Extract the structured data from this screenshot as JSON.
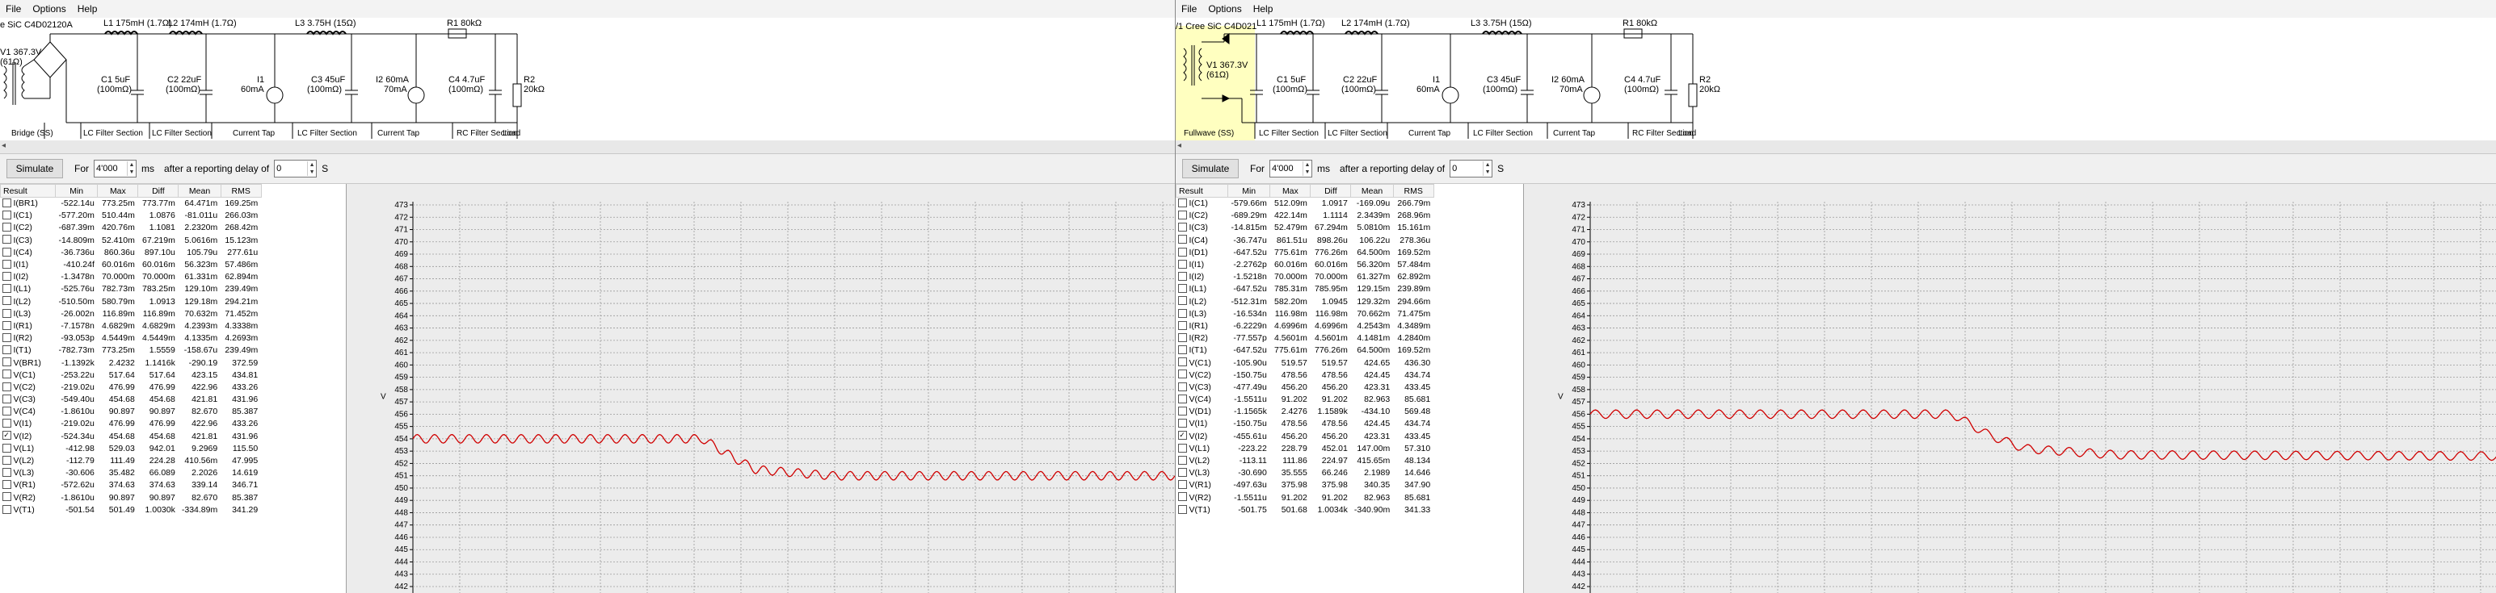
{
  "menu": [
    "File",
    "Options",
    "Help"
  ],
  "toolbar": {
    "simulate_label": "Simulate",
    "for_label": "For",
    "duration_value": "4'000",
    "ms_label": "ms",
    "delay_label": "after a reporting delay of",
    "delay_value": "0",
    "s_label": "S"
  },
  "columns": [
    "Result",
    "Min",
    "Max",
    "Diff",
    "Mean",
    "RMS"
  ],
  "colors": {
    "trace": "#d00000",
    "grid": "#9a9a9a",
    "highlight": "#ffffc0"
  },
  "chart_data": [
    {
      "type": "line",
      "ylim": [
        442,
        473
      ],
      "y_ticks": [
        "473",
        "472",
        "471",
        "470",
        "469",
        "468",
        "467",
        "466",
        "465",
        "464",
        "463",
        "462",
        "461",
        "460",
        "459",
        "458",
        "457",
        "456",
        "455",
        "454",
        "453",
        "452",
        "451",
        "450",
        "449",
        "448",
        "447",
        "446",
        "445",
        "444",
        "443",
        "442"
      ],
      "ylabel": "V",
      "grid": true,
      "series": [
        {
          "x_frac": [
            0.0,
            0.38,
            0.42,
            0.45,
            0.55,
            1.0
          ],
          "values": [
            454.0,
            454.0,
            452.5,
            451.5,
            451.0,
            451.0
          ],
          "ripple": 0.35
        }
      ]
    },
    {
      "type": "line",
      "ylim": [
        442,
        473
      ],
      "y_ticks": [
        "473",
        "472",
        "471",
        "470",
        "469",
        "468",
        "467",
        "466",
        "465",
        "464",
        "463",
        "462",
        "461",
        "460",
        "459",
        "458",
        "457",
        "456",
        "455",
        "454",
        "453",
        "452",
        "451",
        "450",
        "449",
        "448",
        "447",
        "446",
        "445",
        "444",
        "443",
        "442"
      ],
      "ylabel": "V",
      "grid": true,
      "series": [
        {
          "x_frac": [
            0.0,
            0.4,
            0.44,
            0.48,
            0.58,
            1.0
          ],
          "values": [
            456.0,
            456.0,
            454.3,
            453.2,
            452.7,
            452.6
          ],
          "ripple": 0.35
        }
      ]
    }
  ],
  "left": {
    "schematic": {
      "source_label": "V1 367.3V",
      "source_res": "(61Ω)",
      "source_name": "e SiC C4D02120A",
      "l1_label": "L1 175mH (1.7Ω)",
      "l2_label": "L2 174mH (1.7Ω)",
      "l3_label": "L3 3.75H (15Ω)",
      "r1_label": "R1 80kΩ",
      "c1_label": "C1 5uF",
      "c1_esr": "(100mΩ)",
      "c2_label": "C2 22uF",
      "c2_esr": "(100mΩ)",
      "i1_label": "I1",
      "i1_val": "60mA",
      "c3_label": "C3 45uF",
      "c3_esr": "(100mΩ)",
      "i2_label": "I2 60mA",
      "i2_val": "70mA",
      "c4_label": "C4 4.7uF",
      "c4_esr": "(100mΩ)",
      "r2_label": "R2",
      "r2_val": "20kΩ",
      "sections": [
        "Bridge (SS)",
        "LC Filter Section",
        "LC Filter Section",
        "Current Tap",
        "LC Filter Section",
        "Current Tap",
        "RC Filter Section",
        "Load"
      ]
    },
    "rows": [
      {
        "name": "I(BR1)",
        "min": "-522.14u",
        "max": "773.25m",
        "diff": "773.77m",
        "mean": "64.471m",
        "rms": "169.25m",
        "checked": false
      },
      {
        "name": "I(C1)",
        "min": "-577.20m",
        "max": "510.44m",
        "diff": "1.0876",
        "mean": "-81.011u",
        "rms": "266.03m",
        "checked": false
      },
      {
        "name": "I(C2)",
        "min": "-687.39m",
        "max": "420.76m",
        "diff": "1.1081",
        "mean": "2.2320m",
        "rms": "268.42m",
        "checked": false
      },
      {
        "name": "I(C3)",
        "min": "-14.809m",
        "max": "52.410m",
        "diff": "67.219m",
        "mean": "5.0616m",
        "rms": "15.123m",
        "checked": false
      },
      {
        "name": "I(C4)",
        "min": "-36.736u",
        "max": "860.36u",
        "diff": "897.10u",
        "mean": "105.79u",
        "rms": "277.61u",
        "checked": false
      },
      {
        "name": "I(I1)",
        "min": "-410.24f",
        "max": "60.016m",
        "diff": "60.016m",
        "mean": "56.323m",
        "rms": "57.486m",
        "checked": false
      },
      {
        "name": "I(I2)",
        "min": "-1.3478n",
        "max": "70.000m",
        "diff": "70.000m",
        "mean": "61.331m",
        "rms": "62.894m",
        "checked": false
      },
      {
        "name": "I(L1)",
        "min": "-525.76u",
        "max": "782.73m",
        "diff": "783.25m",
        "mean": "129.10m",
        "rms": "239.49m",
        "checked": false
      },
      {
        "name": "I(L2)",
        "min": "-510.50m",
        "max": "580.79m",
        "diff": "1.0913",
        "mean": "129.18m",
        "rms": "294.21m",
        "checked": false
      },
      {
        "name": "I(L3)",
        "min": "-26.002n",
        "max": "116.89m",
        "diff": "116.89m",
        "mean": "70.632m",
        "rms": "71.452m",
        "checked": false
      },
      {
        "name": "I(R1)",
        "min": "-7.1578n",
        "max": "4.6829m",
        "diff": "4.6829m",
        "mean": "4.2393m",
        "rms": "4.3338m",
        "checked": false
      },
      {
        "name": "I(R2)",
        "min": "-93.053p",
        "max": "4.5449m",
        "diff": "4.5449m",
        "mean": "4.1335m",
        "rms": "4.2693m",
        "checked": false
      },
      {
        "name": "I(T1)",
        "min": "-782.73m",
        "max": "773.25m",
        "diff": "1.5559",
        "mean": "-158.67u",
        "rms": "239.49m",
        "checked": false
      },
      {
        "name": "V(BR1)",
        "min": "-1.1392k",
        "max": "2.4232",
        "diff": "1.1416k",
        "mean": "-290.19",
        "rms": "372.59",
        "checked": false
      },
      {
        "name": "V(C1)",
        "min": "-253.22u",
        "max": "517.64",
        "diff": "517.64",
        "mean": "423.15",
        "rms": "434.81",
        "checked": false
      },
      {
        "name": "V(C2)",
        "min": "-219.02u",
        "max": "476.99",
        "diff": "476.99",
        "mean": "422.96",
        "rms": "433.26",
        "checked": false
      },
      {
        "name": "V(C3)",
        "min": "-549.40u",
        "max": "454.68",
        "diff": "454.68",
        "mean": "421.81",
        "rms": "431.96",
        "checked": false
      },
      {
        "name": "V(C4)",
        "min": "-1.8610u",
        "max": "90.897",
        "diff": "90.897",
        "mean": "82.670",
        "rms": "85.387",
        "checked": false
      },
      {
        "name": "V(I1)",
        "min": "-219.02u",
        "max": "476.99",
        "diff": "476.99",
        "mean": "422.96",
        "rms": "433.26",
        "checked": false
      },
      {
        "name": "V(I2)",
        "min": "-524.34u",
        "max": "454.68",
        "diff": "454.68",
        "mean": "421.81",
        "rms": "431.96",
        "checked": true
      },
      {
        "name": "V(L1)",
        "min": "-412.98",
        "max": "529.03",
        "diff": "942.01",
        "mean": "9.2969",
        "rms": "115.50",
        "checked": false
      },
      {
        "name": "V(L2)",
        "min": "-112.79",
        "max": "111.49",
        "diff": "224.28",
        "mean": "410.56m",
        "rms": "47.995",
        "checked": false
      },
      {
        "name": "V(L3)",
        "min": "-30.606",
        "max": "35.482",
        "diff": "66.089",
        "mean": "2.2026",
        "rms": "14.619",
        "checked": false
      },
      {
        "name": "V(R1)",
        "min": "-572.62u",
        "max": "374.63",
        "diff": "374.63",
        "mean": "339.14",
        "rms": "346.71",
        "checked": false
      },
      {
        "name": "V(R2)",
        "min": "-1.8610u",
        "max": "90.897",
        "diff": "90.897",
        "mean": "82.670",
        "rms": "85.387",
        "checked": false
      },
      {
        "name": "V(T1)",
        "min": "-501.54",
        "max": "501.49",
        "diff": "1.0030k",
        "mean": "-334.89m",
        "rms": "341.29",
        "checked": false
      }
    ]
  },
  "right": {
    "schematic": {
      "source_label": "V1 367.3V",
      "source_res": "(61Ω)",
      "source_name": "/1 Cree SiC C4D021",
      "l1_label": "L1 175mH (1.7Ω)",
      "l2_label": "L2 174mH (1.7Ω)",
      "l3_label": "L3 3.75H (15Ω)",
      "r1_label": "R1 80kΩ",
      "c1_label": "C1 5uF",
      "c1_esr": "(100mΩ)",
      "c2_label": "C2 22uF",
      "c2_esr": "(100mΩ)",
      "i1_label": "I1",
      "i1_val": "60mA",
      "c3_label": "C3 45uF",
      "c3_esr": "(100mΩ)",
      "i2_label": "I2 60mA",
      "i2_val": "70mA",
      "c4_label": "C4 4.7uF",
      "c4_esr": "(100mΩ)",
      "r2_label": "R2",
      "r2_val": "20kΩ",
      "sections": [
        "Fullwave (SS)",
        "LC Filter Section",
        "LC Filter Section",
        "Current Tap",
        "LC Filter Section",
        "Current Tap",
        "RC Filter Section",
        "Load"
      ]
    },
    "rows": [
      {
        "name": "I(C1)",
        "min": "-579.66m",
        "max": "512.09m",
        "diff": "1.0917",
        "mean": "-169.09u",
        "rms": "266.79m",
        "checked": false
      },
      {
        "name": "I(C2)",
        "min": "-689.29m",
        "max": "422.14m",
        "diff": "1.1114",
        "mean": "2.3439m",
        "rms": "268.96m",
        "checked": false
      },
      {
        "name": "I(C3)",
        "min": "-14.815m",
        "max": "52.479m",
        "diff": "67.294m",
        "mean": "5.0810m",
        "rms": "15.161m",
        "checked": false
      },
      {
        "name": "I(C4)",
        "min": "-36.747u",
        "max": "861.51u",
        "diff": "898.26u",
        "mean": "106.22u",
        "rms": "278.36u",
        "checked": false
      },
      {
        "name": "I(D1)",
        "min": "-647.52u",
        "max": "775.61m",
        "diff": "776.26m",
        "mean": "64.500m",
        "rms": "169.52m",
        "checked": false
      },
      {
        "name": "I(I1)",
        "min": "-2.2762p",
        "max": "60.016m",
        "diff": "60.016m",
        "mean": "56.320m",
        "rms": "57.484m",
        "checked": false
      },
      {
        "name": "I(I2)",
        "min": "-1.5218n",
        "max": "70.000m",
        "diff": "70.000m",
        "mean": "61.327m",
        "rms": "62.892m",
        "checked": false
      },
      {
        "name": "I(L1)",
        "min": "-647.52u",
        "max": "785.31m",
        "diff": "785.95m",
        "mean": "129.15m",
        "rms": "239.89m",
        "checked": false
      },
      {
        "name": "I(L2)",
        "min": "-512.31m",
        "max": "582.20m",
        "diff": "1.0945",
        "mean": "129.32m",
        "rms": "294.66m",
        "checked": false
      },
      {
        "name": "I(L3)",
        "min": "-16.534n",
        "max": "116.98m",
        "diff": "116.98m",
        "mean": "70.662m",
        "rms": "71.475m",
        "checked": false
      },
      {
        "name": "I(R1)",
        "min": "-6.2229n",
        "max": "4.6996m",
        "diff": "4.6996m",
        "mean": "4.2543m",
        "rms": "4.3489m",
        "checked": false
      },
      {
        "name": "I(R2)",
        "min": "-77.557p",
        "max": "4.5601m",
        "diff": "4.5601m",
        "mean": "4.1481m",
        "rms": "4.2840m",
        "checked": false
      },
      {
        "name": "I(T1)",
        "min": "-647.52u",
        "max": "775.61m",
        "diff": "776.26m",
        "mean": "64.500m",
        "rms": "169.52m",
        "checked": false
      },
      {
        "name": "V(C1)",
        "min": "-105.90u",
        "max": "519.57",
        "diff": "519.57",
        "mean": "424.65",
        "rms": "436.30",
        "checked": false
      },
      {
        "name": "V(C2)",
        "min": "-150.75u",
        "max": "478.56",
        "diff": "478.56",
        "mean": "424.45",
        "rms": "434.74",
        "checked": false
      },
      {
        "name": "V(C3)",
        "min": "-477.49u",
        "max": "456.20",
        "diff": "456.20",
        "mean": "423.31",
        "rms": "433.45",
        "checked": false
      },
      {
        "name": "V(C4)",
        "min": "-1.5511u",
        "max": "91.202",
        "diff": "91.202",
        "mean": "82.963",
        "rms": "85.681",
        "checked": false
      },
      {
        "name": "V(D1)",
        "min": "-1.1565k",
        "max": "2.4276",
        "diff": "1.1589k",
        "mean": "-434.10",
        "rms": "569.48",
        "checked": false
      },
      {
        "name": "V(I1)",
        "min": "-150.75u",
        "max": "478.56",
        "diff": "478.56",
        "mean": "424.45",
        "rms": "434.74",
        "checked": false
      },
      {
        "name": "V(I2)",
        "min": "-455.61u",
        "max": "456.20",
        "diff": "456.20",
        "mean": "423.31",
        "rms": "433.45",
        "checked": true
      },
      {
        "name": "V(L1)",
        "min": "-223.22",
        "max": "228.79",
        "diff": "452.01",
        "mean": "147.00m",
        "rms": "57.310",
        "checked": false
      },
      {
        "name": "V(L2)",
        "min": "-113.11",
        "max": "111.86",
        "diff": "224.97",
        "mean": "415.65m",
        "rms": "48.134",
        "checked": false
      },
      {
        "name": "V(L3)",
        "min": "-30.690",
        "max": "35.555",
        "diff": "66.246",
        "mean": "2.1989",
        "rms": "14.646",
        "checked": false
      },
      {
        "name": "V(R1)",
        "min": "-497.63u",
        "max": "375.98",
        "diff": "375.98",
        "mean": "340.35",
        "rms": "347.90",
        "checked": false
      },
      {
        "name": "V(R2)",
        "min": "-1.5511u",
        "max": "91.202",
        "diff": "91.202",
        "mean": "82.963",
        "rms": "85.681",
        "checked": false
      },
      {
        "name": "V(T1)",
        "min": "-501.75",
        "max": "501.68",
        "diff": "1.0034k",
        "mean": "-340.90m",
        "rms": "341.33",
        "checked": false
      }
    ]
  }
}
